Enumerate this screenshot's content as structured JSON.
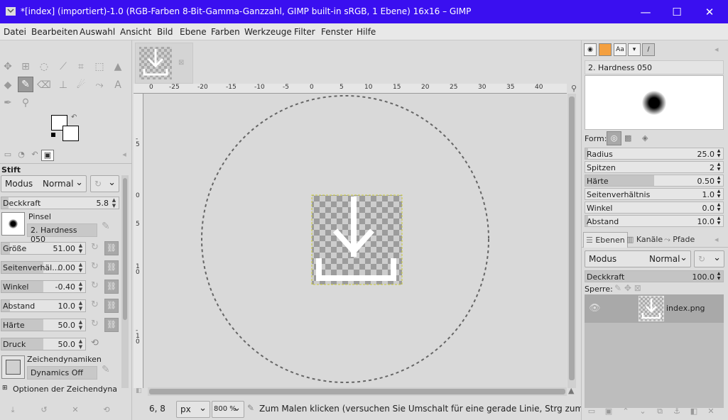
{
  "window": {
    "title": "*[index] (importiert)-1.0 (RGB-Farben 8-Bit-Gamma-Ganzzahl, GIMP built-in sRGB, 1 Ebene) 16x16 – GIMP",
    "minimize": "—",
    "maximize": "☐",
    "close": "✕"
  },
  "menubar": [
    "Datei",
    "Bearbeiten",
    "Auswahl",
    "Ansicht",
    "Bild",
    "Ebene",
    "Farben",
    "Werkzeuge",
    "Filter",
    "Fenster",
    "Hilfe"
  ],
  "tool_options": {
    "title": "Stift",
    "mode_label": "Modus",
    "mode_value": "Normal",
    "opacity": {
      "label": "Deckkraft",
      "value": "5.8",
      "fraction": 0.058
    },
    "brush_section_label": "Pinsel",
    "brush_name": "2. Hardness 050",
    "size": {
      "label": "Größe",
      "value": "51.00",
      "fraction": 0.1
    },
    "aspect": {
      "label": "Seitenverhäl...",
      "value": "0.00",
      "fraction": 0.5
    },
    "angle": {
      "label": "Winkel",
      "value": "-0.40",
      "fraction": 0.5
    },
    "spacing": {
      "label": "Abstand",
      "value": "10.0",
      "fraction": 0.1
    },
    "hardness": {
      "label": "Härte",
      "value": "50.0",
      "fraction": 0.5
    },
    "force": {
      "label": "Druck",
      "value": "50.0",
      "fraction": 0.5
    },
    "dynamics_label": "Zeichendynamiken",
    "dynamics_value": "Dynamics Off",
    "dynamics_options": "Optionen der Zeichendynamik"
  },
  "ruler": {
    "h_ticks": [
      "0",
      "-25",
      "-20",
      "-15",
      "-10",
      "-5",
      "0",
      "5",
      "10",
      "15",
      "20",
      "25",
      "30",
      "35",
      "40"
    ],
    "v_ticks": [
      "-5",
      "0",
      "5",
      "10",
      "-10"
    ]
  },
  "status": {
    "coords": "6, 8",
    "unit": "px",
    "zoom": "800 %",
    "message": "Zum Malen klicken (versuchen Sie Umschalt für eine gerade Linie, Strg zum Wähle..."
  },
  "brush_editor": {
    "brush_name": "2. Hardness 050",
    "shape_label": "Form:",
    "rows": [
      {
        "label": "Radius",
        "value": "25.0",
        "fraction": 0.02
      },
      {
        "label": "Spitzen",
        "value": "2",
        "fraction": 0.0
      },
      {
        "label": "Härte",
        "value": "0.50",
        "fraction": 0.5
      },
      {
        "label": "Seitenverhältnis",
        "value": "1.0",
        "fraction": 0.0
      },
      {
        "label": "Winkel",
        "value": "0.0",
        "fraction": 0.0
      },
      {
        "label": "Abstand",
        "value": "10.0",
        "fraction": 0.02
      }
    ]
  },
  "layers": {
    "tabs": [
      "Ebenen",
      "Kanäle",
      "Pfade"
    ],
    "mode_label": "Modus",
    "mode_value": "Normal",
    "opacity": {
      "label": "Deckkraft",
      "value": "100.0",
      "fraction": 1.0
    },
    "lock_label": "Sperre:",
    "items": [
      {
        "name": "index.png",
        "visible": true
      }
    ]
  },
  "colors": {
    "titlebar": "#3a0ff0",
    "accent": "#9a9a9a"
  }
}
